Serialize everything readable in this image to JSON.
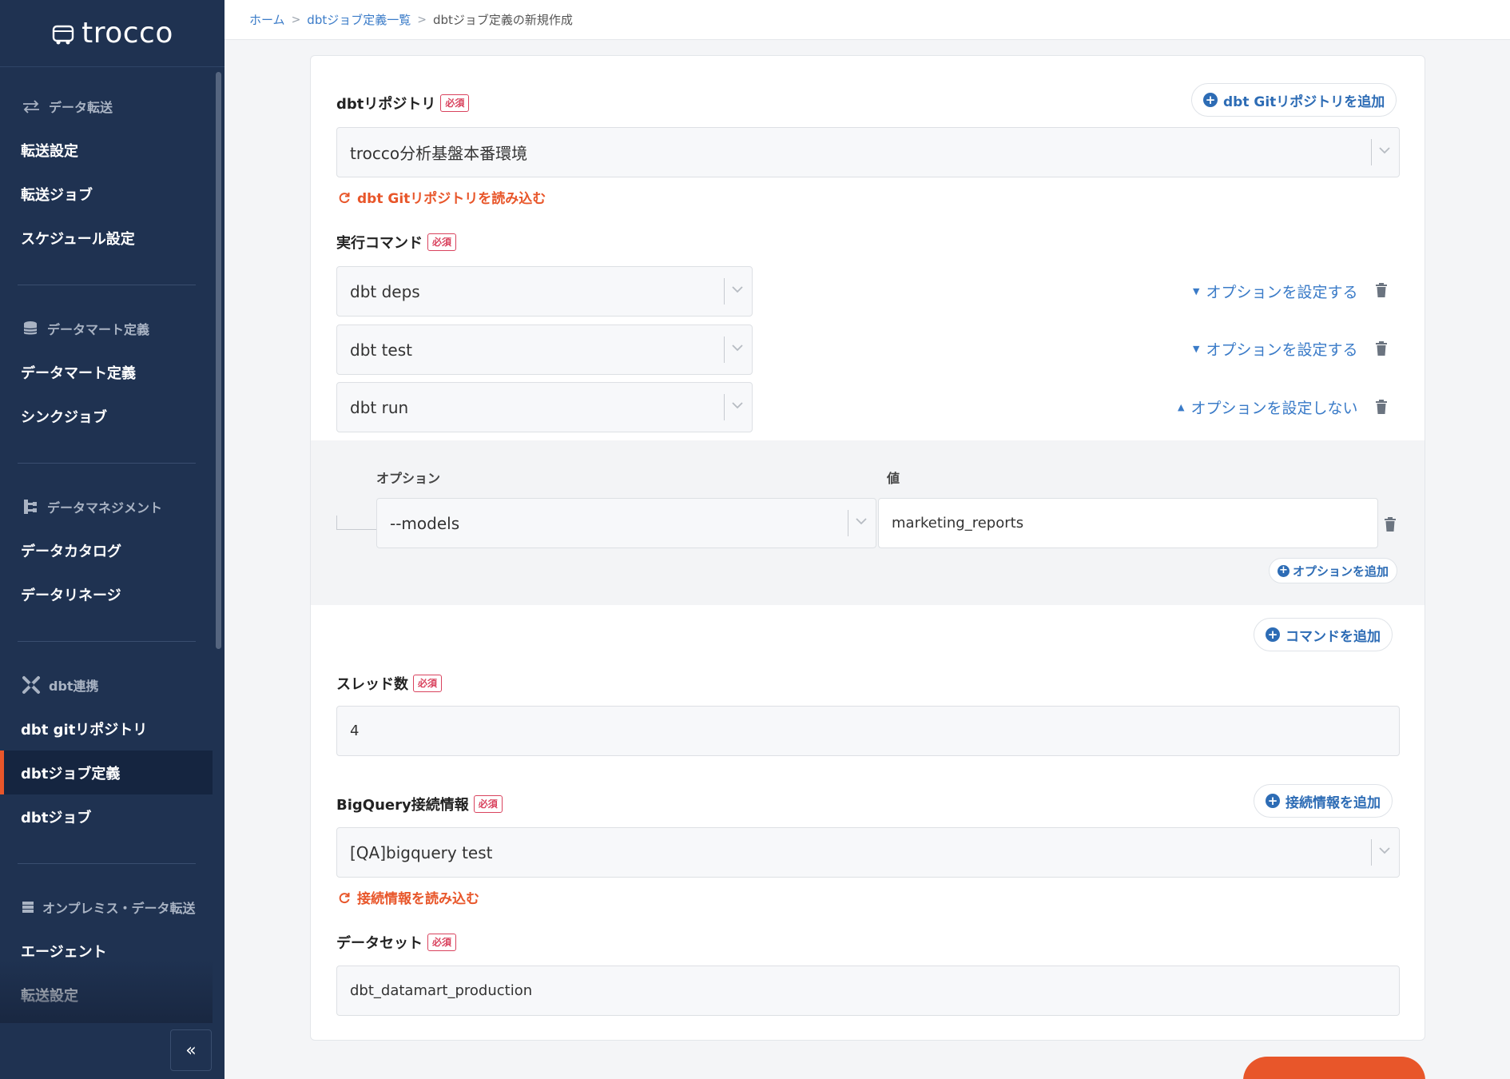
{
  "app": {
    "logo_text": "trocco"
  },
  "sidebar": {
    "sections": [
      {
        "head": "データ転送",
        "items": [
          "転送設定",
          "転送ジョブ",
          "スケジュール設定"
        ]
      },
      {
        "head": "データマート定義",
        "items": [
          "データマート定義",
          "シンクジョブ"
        ]
      },
      {
        "head": "データマネジメント",
        "items": [
          "データカタログ",
          "データリネージ"
        ]
      },
      {
        "head": "dbt連携",
        "items": [
          "dbt gitリポジトリ",
          "dbtジョブ定義",
          "dbtジョブ"
        ]
      },
      {
        "head": "オンプレミス・データ転送",
        "items": [
          "エージェント",
          "転送設定"
        ]
      }
    ],
    "active_item": "dbtジョブ定義",
    "collapse_label": "«"
  },
  "breadcrumb": {
    "home": "ホーム",
    "list": "dbtジョブ定義一覧",
    "current": "dbtジョブ定義の新規作成",
    "sep": ">"
  },
  "form": {
    "required_badge": "必須",
    "repo": {
      "label": "dbtリポジトリ",
      "add_button": "dbt Gitリポジトリを追加",
      "value": "trocco分析基盤本番環境",
      "reload_link": "dbt Gitリポジトリを読み込む"
    },
    "commands": {
      "label": "実行コマンド",
      "items": [
        {
          "value": "dbt deps",
          "option_link": "オプションを設定する",
          "expanded": false
        },
        {
          "value": "dbt test",
          "option_link": "オプションを設定する",
          "expanded": false
        },
        {
          "value": "dbt run",
          "option_link": "オプションを設定しない",
          "expanded": true
        }
      ],
      "options": {
        "col_option": "オプション",
        "col_value": "値",
        "rows": [
          {
            "option": "--models",
            "value": "marketing_reports"
          }
        ],
        "add_option_button": "オプションを追加"
      },
      "add_command_button": "コマンドを追加"
    },
    "threads": {
      "label": "スレッド数",
      "value": "4"
    },
    "bigquery": {
      "label": "BigQuery接続情報",
      "add_button": "接続情報を追加",
      "value": "[QA]bigquery test",
      "reload_link": "接続情報を読み込む"
    },
    "dataset": {
      "label": "データセット",
      "value": "dbt_datamart_production"
    }
  },
  "colors": {
    "sidebar_bg": "#1f3251",
    "accent": "#e8562a",
    "link": "#2d6cb5",
    "required": "#d9435e"
  }
}
